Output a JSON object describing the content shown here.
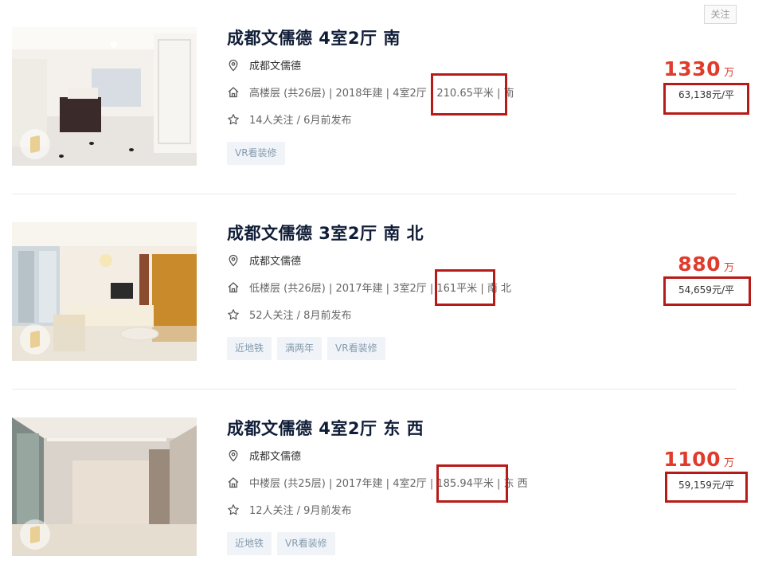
{
  "follow_button": "关注",
  "listings": [
    {
      "title": "成都文儒德 4室2厅 南",
      "community": "成都文儒德",
      "info_pre": "高楼层 (共26层) | 2018年建 | 4室2厅 |",
      "area": "210.65平米",
      "info_post": "| 南",
      "follow_info": "14人关注 / 6月前发布",
      "tags": [
        "VR看装修"
      ],
      "price": "1330",
      "price_unit": "万",
      "unit_price": "63,138元/平"
    },
    {
      "title": "成都文儒德 3室2厅 南 北",
      "community": "成都文儒德",
      "info_pre": "低楼层 (共26层) | 2017年建 | 3室2厅 |",
      "area": "161平米",
      "info_post": "| 南 北",
      "follow_info": "52人关注 / 8月前发布",
      "tags": [
        "近地铁",
        "满两年",
        "VR看装修"
      ],
      "price": "880",
      "price_unit": "万",
      "unit_price": "54,659元/平"
    },
    {
      "title": "成都文儒德 4室2厅 东 西",
      "community": "成都文儒德",
      "info_pre": "中楼层 (共25层) | 2017年建 | 4室2厅 |",
      "area": "185.94平米",
      "info_post": "| 东 西",
      "follow_info": "12人关注 / 9月前发布",
      "tags": [
        "近地铁",
        "VR看装修"
      ],
      "price": "1100",
      "price_unit": "万",
      "unit_price": "59,159元/平"
    }
  ],
  "icons": {
    "location": "location-pin-icon",
    "house": "house-icon",
    "star": "star-icon"
  },
  "colors": {
    "price": "#e03c2d",
    "highlight": "#b81b17",
    "title": "#101d37",
    "tag_bg": "#f0f4f8",
    "tag_text": "#849aae"
  }
}
